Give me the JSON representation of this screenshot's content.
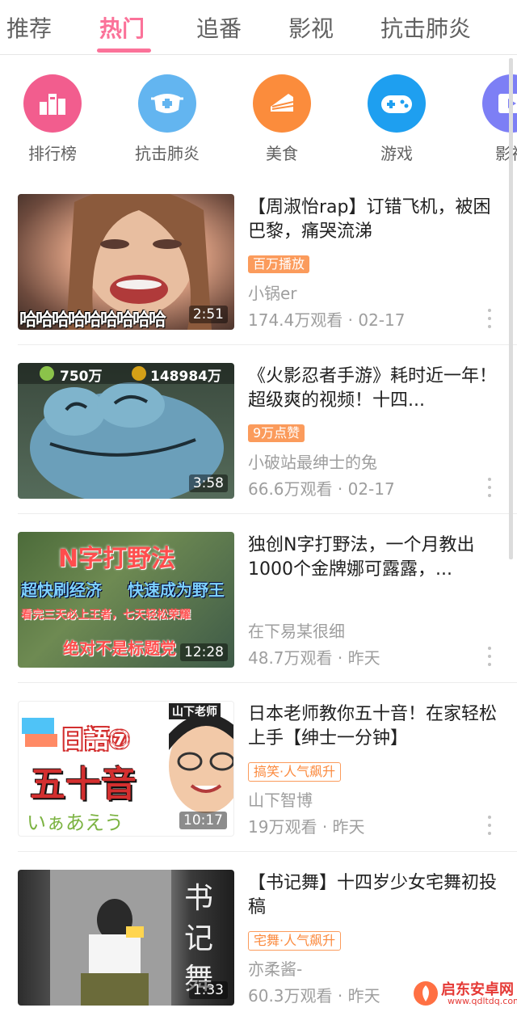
{
  "tabs": [
    {
      "label": "推荐",
      "active": false
    },
    {
      "label": "热门",
      "active": true
    },
    {
      "label": "追番",
      "active": false
    },
    {
      "label": "影视",
      "active": false
    },
    {
      "label": "抗击肺炎",
      "active": false
    }
  ],
  "categories": [
    {
      "label": "排行榜",
      "icon": "ranking-icon",
      "color": "#f25d8e"
    },
    {
      "label": "抗击肺炎",
      "icon": "mask-icon",
      "color": "#63b5f0"
    },
    {
      "label": "美食",
      "icon": "cake-icon",
      "color": "#fb8c3c"
    },
    {
      "label": "游戏",
      "icon": "gamepad-icon",
      "color": "#1e9ff0"
    },
    {
      "label": "影视",
      "icon": "film-icon",
      "color": "#7d7ff5"
    }
  ],
  "videos": [
    {
      "title": "【周淑怡rap】订错飞机，被困巴黎，痛哭流涕",
      "badge": "百万播放",
      "badge_style": "fill",
      "author": "小锅er",
      "views": "174.4万观看",
      "date": "02-17",
      "duration": "2:51",
      "thumb_caption": "哈哈哈哈哈哈哈哈哈"
    },
    {
      "title": "《火影忍者手游》耗时近一年！超级爽的视频！十四...",
      "badge": "9万点赞",
      "badge_style": "fill",
      "author": "小破站最绅士的兔",
      "views": "66.6万观看",
      "date": "02-17",
      "duration": "3:58",
      "thumb_stat_left": "750万",
      "thumb_stat_right": "148984万"
    },
    {
      "title": "独创N字打野法，一个月教出1000个金牌娜可露露，...",
      "badge": "",
      "badge_style": "none",
      "author": "在下易某很细",
      "views": "48.7万观看",
      "date": "昨天",
      "duration": "12:28",
      "thumb_lines": [
        "N字打野法",
        "超快刷经济",
        "快速成为野王",
        "看完三天必上王者，七天轻松荣耀",
        "绝对不是标题党"
      ]
    },
    {
      "title": "日本老师教你五十音！在家轻松上手【绅士一分钟】",
      "badge": "搞笑·人气飙升",
      "badge_style": "outline",
      "author": "山下智博",
      "views": "19万观看",
      "date": "昨天",
      "duration": "10:17",
      "thumb_lines": [
        "日語⑦",
        "五十音",
        "山下老师",
        "いぁあえう"
      ]
    },
    {
      "title": "【书记舞】十四岁少女宅舞初投稿",
      "badge": "宅舞·人气飙升",
      "badge_style": "outline",
      "author": "亦柔酱-",
      "views": "60.3万观看",
      "date": "昨天",
      "duration": "1:33",
      "thumb_lines": [
        "书",
        "记",
        "舞"
      ]
    }
  ],
  "separator": "·",
  "watermark": {
    "brand": "启东安卓网",
    "url": "www.qdltdq.com"
  },
  "colors": {
    "accent": "#fb7299",
    "badge": "#fb9b5c",
    "muted": "#9e9e9e"
  }
}
